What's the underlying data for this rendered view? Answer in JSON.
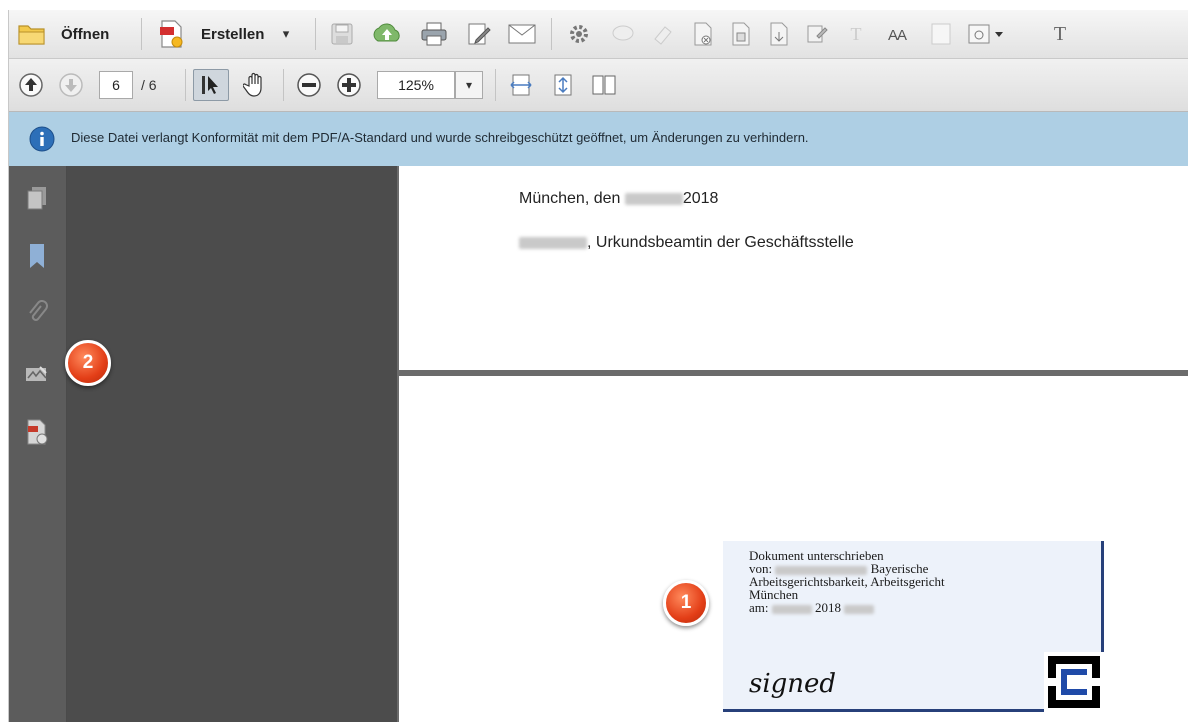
{
  "toolbar": {
    "open_label": "Öffnen",
    "create_label": "Erstellen",
    "dropdown_arrow": "▾",
    "text_tool_glyph": "T",
    "font_size_glyph": "AA"
  },
  "navbar": {
    "page_number": "6",
    "page_total": "/ 6",
    "zoom": "125%"
  },
  "info": {
    "message": "Diese Datei verlangt Konformität mit dem PDF/A-Standard und wurde schreibgeschützt geöffnet, um Änderungen zu verhindern."
  },
  "document": {
    "place_prefix": "München, den",
    "place_year": "2018",
    "role_suffix": ", Urkundsbeamtin der Geschäftsstelle",
    "signature": {
      "line1": "Dokument unterschrieben",
      "line2_prefix": "von:",
      "line2_suffix": "Bayerische",
      "line3": "Arbeitsgerichtsbarkeit, Arbeitsgericht",
      "line4": "München",
      "line5_prefix": "am:",
      "line5_year": "2018",
      "signed": "signed"
    }
  },
  "badges": {
    "one": "1",
    "two": "2"
  },
  "colors": {
    "info_bar": "#aecfe4",
    "badge": "#e33e17",
    "signature_border": "#27407a"
  }
}
